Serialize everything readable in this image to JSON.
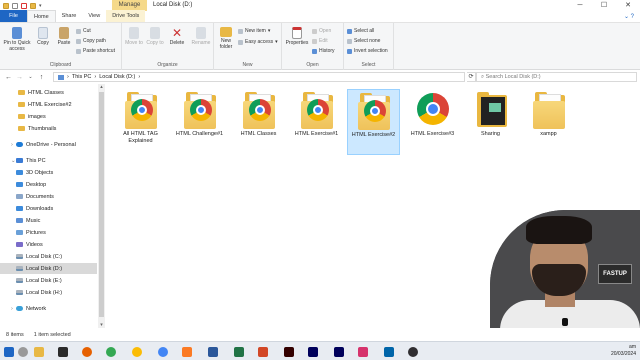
{
  "window": {
    "manage_tab": "Manage",
    "title": "Local Disk (D:)",
    "controls": [
      "─",
      "☐",
      "✕"
    ]
  },
  "ribbon_tabs": [
    "File",
    "Home",
    "Share",
    "View",
    "Drive Tools"
  ],
  "ribbon": {
    "clipboard": {
      "pin": "Pin to Quick access",
      "copy": "Copy",
      "paste": "Paste",
      "cut": "Cut",
      "copy_path": "Copy path",
      "paste_shortcut": "Paste shortcut",
      "label": "Clipboard"
    },
    "organize": {
      "move_to": "Move to",
      "copy_to": "Copy to",
      "delete": "Delete",
      "rename": "Rename",
      "label": "Organize"
    },
    "new": {
      "new_folder": "New folder",
      "new_item": "New item",
      "easy_access": "Easy access",
      "label": "New"
    },
    "open": {
      "properties": "Properties",
      "open": "Open",
      "edit": "Edit",
      "history": "History",
      "label": "Open"
    },
    "select": {
      "select_all": "Select all",
      "select_none": "Select none",
      "invert": "Invert selection",
      "label": "Select"
    }
  },
  "address": {
    "path": [
      "This PC",
      "Local Disk (D:)"
    ],
    "search_placeholder": "Search Local Disk (D:)"
  },
  "sidebar": {
    "items": [
      {
        "label": "HTML Classes",
        "icon": "folder-icon"
      },
      {
        "label": "HTML Exercise#2",
        "icon": "folder-icon"
      },
      {
        "label": "images",
        "icon": "folder-icon"
      },
      {
        "label": "Thumbnails",
        "icon": "folder-icon"
      },
      {
        "label": "OneDrive - Personal",
        "icon": "cloud-icon"
      },
      {
        "label": "This PC",
        "icon": "computer-icon"
      },
      {
        "label": "3D Objects",
        "icon": "cube-icon"
      },
      {
        "label": "Desktop",
        "icon": "desktop-icon"
      },
      {
        "label": "Documents",
        "icon": "documents-icon"
      },
      {
        "label": "Downloads",
        "icon": "downloads-icon"
      },
      {
        "label": "Music",
        "icon": "music-icon"
      },
      {
        "label": "Pictures",
        "icon": "pictures-icon"
      },
      {
        "label": "Videos",
        "icon": "videos-icon"
      },
      {
        "label": "Local Disk (C:)",
        "icon": "drive-icon"
      },
      {
        "label": "Local Disk (D:)",
        "icon": "drive-icon"
      },
      {
        "label": "Local Disk (E:)",
        "icon": "drive-icon"
      },
      {
        "label": "Local Disk (H:)",
        "icon": "drive-icon"
      },
      {
        "label": "Network",
        "icon": "network-icon"
      }
    ]
  },
  "files": [
    {
      "label": "All HTML TAG Explained",
      "icon": "chrome-folder-icon"
    },
    {
      "label": "HTML Challenge#1",
      "icon": "chrome-folder-icon"
    },
    {
      "label": "HTML Classes",
      "icon": "chrome-folder-icon"
    },
    {
      "label": "HTML Exercise#1",
      "icon": "chrome-folder-icon"
    },
    {
      "label": "HTML Exercise#2",
      "icon": "chrome-folder-icon"
    },
    {
      "label": "HTML Exercise#3",
      "icon": "chrome-icon"
    },
    {
      "label": "Sharing",
      "icon": "dark-folder-icon"
    },
    {
      "label": "xampp",
      "icon": "folder-icon"
    }
  ],
  "webcam": {
    "logo_text": "FASTUP"
  },
  "status": {
    "item_count": "8 items",
    "selection": "1 item selected"
  },
  "taskbar": {
    "time": "am",
    "date": "20/03/2024"
  },
  "colors": {
    "accent": "#1e66c4",
    "manage_tab": "#f5d98a",
    "selection": "#cce8ff",
    "folder": "#e9b740"
  }
}
